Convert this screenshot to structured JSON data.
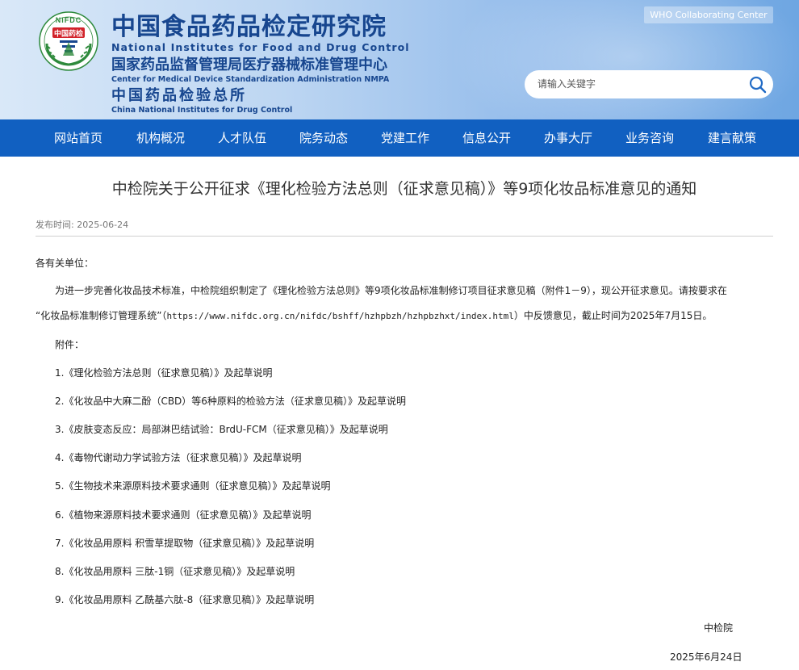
{
  "header": {
    "logo_top_text": "NIFDC",
    "logo_badge_text": "中国药检",
    "brand_cn": "中国食品药品检定研究院",
    "brand_en": "National Institutes for Food and Drug Control",
    "sub1_cn": "国家药品监督管理局医疗器械标准管理中心",
    "sub1_en": "Center for Medical Device Standardization Administration NMPA",
    "sub2_cn": "中国药品检验总所",
    "sub2_en": "China National Institutes for Drug Control",
    "who_label": "WHO Collaborating Center",
    "search_placeholder": "请输入关键字"
  },
  "nav": {
    "items": [
      "网站首页",
      "机构概况",
      "人才队伍",
      "院务动态",
      "党建工作",
      "信息公开",
      "办事大厅",
      "业务咨询",
      "建言献策"
    ]
  },
  "article": {
    "title": "中检院关于公开征求《理化检验方法总则（征求意见稿）》等9项化妆品标准意见的通知",
    "meta": "发布时间:  2025-06-24",
    "salutation": "各有关单位：",
    "para1_line1": "为进一步完善化妆品技术标准，中检院组织制定了《理化检验方法总则》等9项化妆品标准制修订项目征求意见稿（附件1－9），现公开征求意见。请按要求在",
    "para1_line2_a": "“化妆品标准制修订管理系统”（",
    "para1_line2_url": "https://www.nifdc.org.cn/nifdc/bshff/hzhpbzh/hzhpbzhxt/index.html",
    "para1_line2_b": "）中反馈意见，截止时间为2025年7月15日。",
    "attachments_label": "附件：",
    "attachments": [
      "1.《理化检验方法总则（征求意见稿）》及起草说明",
      "2.《化妆品中大麻二酚（CBD）等6种原料的检验方法（征求意见稿）》及起草说明",
      "3.《皮肤变态反应：局部淋巴结试验：BrdU-FCM（征求意见稿）》及起草说明",
      "4.《毒物代谢动力学试验方法（征求意见稿）》及起草说明",
      "5.《生物技术来源原料技术要求通则（征求意见稿）》及起草说明",
      "6.《植物来源原料技术要求通则（征求意见稿）》及起草说明",
      "7.《化妆品用原料  积雪草提取物（征求意见稿）》及起草说明",
      "8.《化妆品用原料  三肽-1铜（征求意见稿）》及起草说明",
      "9.《化妆品用原料  乙酰基六肽-8（征求意见稿）》及起草说明"
    ],
    "signature": "中检院",
    "date": "2025年6月24日"
  },
  "colors": {
    "nav_bg": "#1160c1",
    "brand_text": "#17468f",
    "logo_green": "#2e8a3c",
    "logo_red": "#d2232a"
  },
  "icons": {
    "search": "magnifier",
    "logo": "nifdc-emblem"
  }
}
